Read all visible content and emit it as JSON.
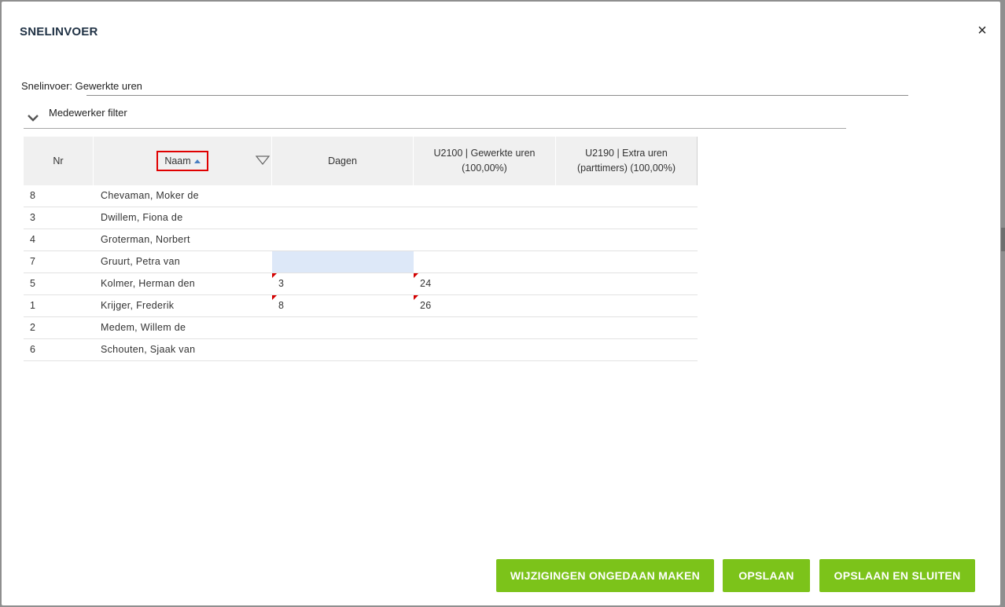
{
  "dialog": {
    "title": "SNELINVOER",
    "close_symbol": "×",
    "snelinvoer_label": "Snelinvoer: Gewerkte uren",
    "filter_label": "Medewerker filter"
  },
  "grid": {
    "headers": {
      "nr": "Nr",
      "naam": "Naam",
      "dagen": "Dagen",
      "u2100_line1": "U2100 | Gewerkte uren",
      "u2100_line2": "(100,00%)",
      "u2190_line1": "U2190 | Extra uren",
      "u2190_line2": "(parttimers) (100,00%)"
    },
    "sort": {
      "column": "Naam",
      "direction": "ascending"
    },
    "rows": [
      {
        "nr": "8",
        "naam": "Chevaman, Moker de",
        "dagen": "",
        "u2100": "",
        "u2190": ""
      },
      {
        "nr": "3",
        "naam": "Dwillem, Fiona de",
        "dagen": "",
        "u2100": "",
        "u2190": ""
      },
      {
        "nr": "4",
        "naam": "Groterman, Norbert",
        "dagen": "",
        "u2100": "",
        "u2190": ""
      },
      {
        "nr": "7",
        "naam": "Gruurt, Petra van",
        "dagen": "",
        "u2100": "",
        "u2190": ""
      },
      {
        "nr": "5",
        "naam": "Kolmer, Herman den",
        "dagen": "3",
        "u2100": "24",
        "u2190": ""
      },
      {
        "nr": "1",
        "naam": "Krijger, Frederik",
        "dagen": "8",
        "u2100": "26",
        "u2190": ""
      },
      {
        "nr": "2",
        "naam": "Medem, Willem de",
        "dagen": "",
        "u2100": "",
        "u2190": ""
      },
      {
        "nr": "6",
        "naam": "Schouten, Sjaak van",
        "dagen": "",
        "u2100": "",
        "u2190": ""
      }
    ]
  },
  "buttons": {
    "undo": "WIJZIGINGEN ONGEDAAN MAKEN",
    "save": "OPSLAAN",
    "save_close": "OPSLAAN EN SLUITEN"
  },
  "colors": {
    "button_green": "#7cc31a",
    "selected_cell": "#dde8f8",
    "highlight_box": "#e00000",
    "changed_flag": "#d40000",
    "header_bg": "#f0f0f0"
  },
  "icons": {
    "close": "close-icon",
    "filter_toggle": "chevron-down-icon",
    "sort": "sort-ascending-icon",
    "column_filter": "filter-triangle-icon"
  }
}
